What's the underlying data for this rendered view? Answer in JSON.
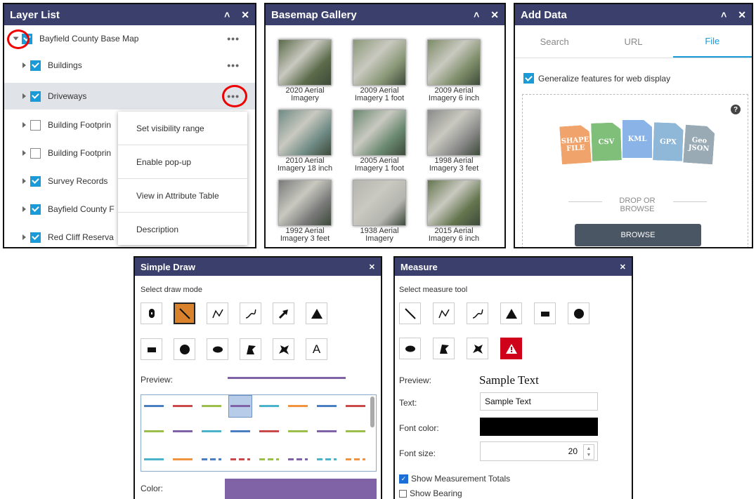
{
  "layer_list": {
    "title": "Layer List",
    "collapse_icon": "double-chevron-up-icon",
    "close_icon": "close-icon",
    "layers": [
      {
        "label": "Bayfield County Base Map",
        "checked": true,
        "has_dots": true
      },
      {
        "label": "Buildings",
        "checked": true,
        "has_dots": true
      },
      {
        "label": "Driveways",
        "checked": true,
        "has_dots": true
      },
      {
        "label": "Building Footprin",
        "checked": false,
        "has_dots": false
      },
      {
        "label": "Building Footprin",
        "checked": false,
        "has_dots": false
      },
      {
        "label": "Survey Records",
        "checked": true,
        "has_dots": false
      },
      {
        "label": "Bayfield County F",
        "checked": true,
        "has_dots": false
      },
      {
        "label": "Red Cliff Reserva",
        "checked": true,
        "has_dots": false
      }
    ],
    "menu": [
      "Set visibility range",
      "Enable pop-up",
      "View in Attribute Table",
      "Description"
    ]
  },
  "basemap": {
    "title": "Basemap Gallery",
    "items": [
      {
        "line1": "2020 Aerial",
        "line2": "Imagery",
        "tone": "#5b6b4a"
      },
      {
        "line1": "2009 Aerial",
        "line2": "Imagery 1 foot",
        "tone": "#8a9878"
      },
      {
        "line1": "2009 Aerial",
        "line2": "Imagery 6 inch",
        "tone": "#7d8c68"
      },
      {
        "line1": "2010 Aerial",
        "line2": "Imagery 18 inch",
        "tone": "#6f8b85"
      },
      {
        "line1": "2005 Aerial",
        "line2": "Imagery 1 foot",
        "tone": "#6a8870"
      },
      {
        "line1": "1998 Aerial",
        "line2": "Imagery 3 feet",
        "tone": "#8a8a8a"
      },
      {
        "line1": "1992 Aerial",
        "line2": "Imagery 3 feet",
        "tone": "#7a7a7a"
      },
      {
        "line1": "1938 Aerial",
        "line2": "Imagery",
        "tone": "#b5b5b0"
      },
      {
        "line1": "2015 Aerial",
        "line2": "Imagery 6 inch",
        "tone": "#65764f"
      }
    ]
  },
  "add_data": {
    "title": "Add Data",
    "tabs": [
      "Search",
      "URL",
      "File"
    ],
    "active_tab": "File",
    "generalize_label": "Generalize features for web display",
    "files": [
      {
        "label": "SHAPE FILE",
        "color": "#f0a46b"
      },
      {
        "label": "CSV",
        "color": "#7fbf7a"
      },
      {
        "label": "KML",
        "color": "#8ab4e8"
      },
      {
        "label": "GPX",
        "color": "#8fb7d8"
      },
      {
        "label": "Geo JSON",
        "color": "#9aaab5"
      }
    ],
    "drop_label": "DROP OR BROWSE",
    "browse_label": "BROWSE"
  },
  "simple_draw": {
    "title": "Simple Draw",
    "mode_label": "Select draw mode",
    "tools_row1": [
      "point-icon",
      "line-icon",
      "polyline-icon",
      "freehand-line-icon",
      "arrow-icon",
      "triangle-icon"
    ],
    "tools_row2": [
      "rectangle-icon",
      "circle-icon",
      "ellipse-icon",
      "polygon-icon",
      "freehand-polygon-icon",
      "text-icon"
    ],
    "text_tool_glyph": "A",
    "preview_label": "Preview:",
    "color_label": "Color:",
    "accent": "#8063a6"
  },
  "measure": {
    "title": "Measure",
    "tool_label": "Select measure tool",
    "preview_label": "Preview:",
    "sample_text": "Sample Text",
    "text_label": "Text:",
    "text_value": "Sample Text",
    "font_color_label": "Font color:",
    "font_size_label": "Font size:",
    "font_size_value": "20",
    "show_totals_label": "Show Measurement Totals",
    "show_bearing_label": "Show Bearing"
  }
}
